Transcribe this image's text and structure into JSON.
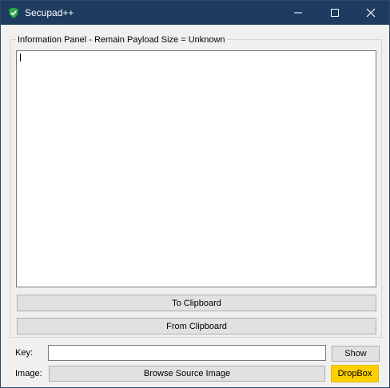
{
  "window": {
    "title": "Secupad++"
  },
  "info_panel": {
    "label": "Information Panel - Remain Payload Size = Unknown",
    "text": ""
  },
  "buttons": {
    "to_clipboard": "To Clipboard",
    "from_clipboard": "From Clipboard",
    "show": "Show",
    "browse": "Browse Source Image",
    "dropbox": "DropBox"
  },
  "fields": {
    "key_label": "Key:",
    "key_value": "",
    "image_label": "Image:"
  },
  "icons": [
    "check-shield-icon",
    "minimize-icon",
    "maximize-icon",
    "close-icon"
  ],
  "colors": {
    "titlebar": "#1d3c5f",
    "dropbox": "#ffd000",
    "window_bg": "#f0f0f0"
  }
}
